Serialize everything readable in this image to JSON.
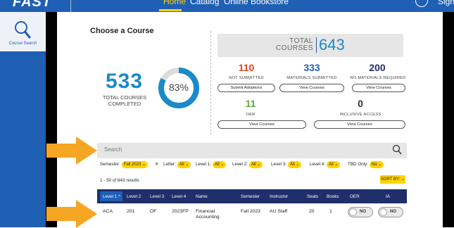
{
  "topnav": {
    "logo": "FAST",
    "items": [
      {
        "label": "Home"
      },
      {
        "label": "Catalog"
      },
      {
        "label": "Online Bookstore"
      }
    ],
    "signout": "Sign Out"
  },
  "sidebar": {
    "items": [
      {
        "label": "Course Search",
        "icon": "search-icon"
      }
    ]
  },
  "page_title": "Choose a Course",
  "completed": {
    "count": "533",
    "label": "TOTAL COURSES COMPLETED",
    "percent_label": "83%",
    "percent_value": 83
  },
  "total": {
    "label_line1": "TOTAL",
    "label_line2": "COURSES",
    "count": "643"
  },
  "stats": [
    {
      "count": "110",
      "label": "NOT SUBMITTED",
      "button": "Submit Adoptions",
      "color": "#e0451d"
    },
    {
      "count": "333",
      "label": "MATERIALS SUBMITTED",
      "button": "View Courses",
      "color": "#1f5fb4"
    },
    {
      "count": "200",
      "label": "NO MATERIALS REQUIRED",
      "button": "View Courses",
      "color": "#1e2f6b"
    },
    {
      "count": "11",
      "label": "OER",
      "button": "View Courses",
      "color": "#5aaa3c"
    },
    {
      "count": "0",
      "label": "INCLUSIVE ACCESS",
      "button": "View Courses",
      "color": "#333333"
    }
  ],
  "search": {
    "placeholder": "Search"
  },
  "filters": {
    "semester_label": "Semester:",
    "semester_value": "Fall 2023",
    "clear": "✕",
    "letter_label": "Letter:",
    "letter_value": "All",
    "level1_label": "Level 1:",
    "level1_value": "All",
    "level2_label": "Level 2:",
    "level2_value": "All",
    "level3_label": "Level 3:",
    "level3_value": "All",
    "level4_label": "Level 4:",
    "level4_value": "All",
    "tbd_label": "TBD Only:",
    "tbd_value": "No"
  },
  "results_text": "1 - 50 of 643 results",
  "sort_label": "SORT BY:",
  "table": {
    "columns": [
      "Level 1",
      "Level 2",
      "Level 3",
      "Level 4",
      "Name",
      "Semester",
      "Instructor",
      "Seats",
      "Books",
      "OER",
      "IA"
    ],
    "rows": [
      {
        "level1": "ACA",
        "level2": "201",
        "level3": "OF",
        "level4": "2023FP",
        "name_line1": "Financial",
        "name_line2": "Accounting",
        "semester": "Fall 2023",
        "instructor": "AU Staff",
        "seats": "20",
        "books": "1",
        "oer": "NO",
        "ia": "NO"
      }
    ]
  },
  "colors": {
    "nav_blue": "#1f5fb4",
    "accent_yellow": "#ffd200",
    "table_header": "#1e2f6b",
    "completed_blue": "#1a8ac8",
    "arrow_orange": "#f5a623"
  }
}
